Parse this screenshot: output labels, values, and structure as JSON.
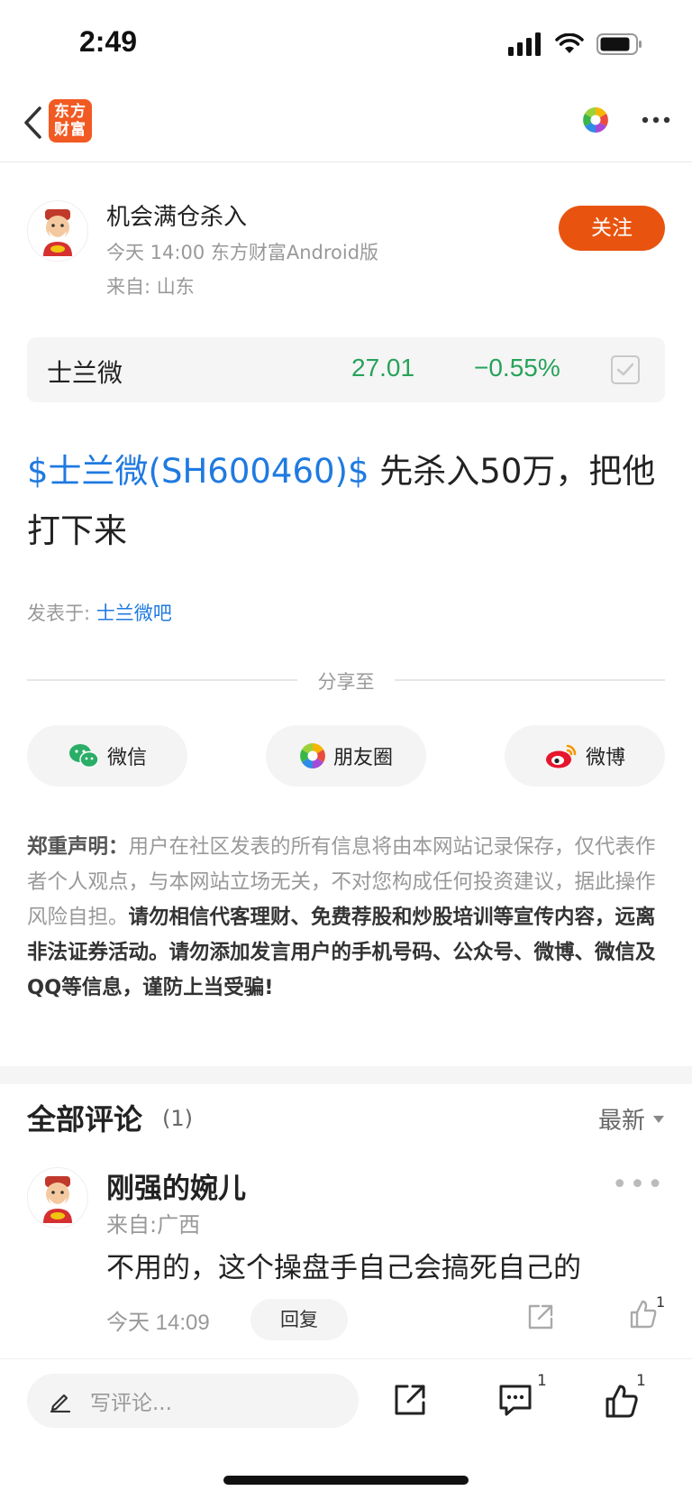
{
  "status_bar": {
    "time": "2:49"
  },
  "nav": {
    "logo_text_line1": "东方",
    "logo_text_line2": "财富"
  },
  "author": {
    "name": "机会满仓杀入",
    "meta": "今天 14:00 东方财富Android版",
    "location": "来自: 山东",
    "follow_label": "关注"
  },
  "stock": {
    "name": "士兰微",
    "price": "27.01",
    "change": "−0.55%"
  },
  "post": {
    "stock_link": "$士兰微(SH600460)$",
    "text": "先杀入50万，把他打下来",
    "posted_in_label": "发表于:",
    "posted_in_link": "士兰微吧"
  },
  "share": {
    "label": "分享至",
    "buttons": [
      {
        "label": "微信",
        "icon": "wechat-icon"
      },
      {
        "label": "朋友圈",
        "icon": "moments-icon"
      },
      {
        "label": "微博",
        "icon": "weibo-icon"
      }
    ]
  },
  "disclaimer": {
    "title": "郑重声明：",
    "normal": "用户在社区发表的所有信息将由本网站记录保存，仅代表作者个人观点，与本网站立场无关，不对您构成任何投资建议，据此操作风险自担。",
    "bold": "请勿相信代客理财、免费荐股和炒股培训等宣传内容，远离非法证券活动。请勿添加发言用户的手机号码、公众号、微博、微信及QQ等信息，谨防上当受骗!"
  },
  "comments": {
    "title": "全部评论",
    "count": "(1)",
    "sort_label": "最新",
    "items": [
      {
        "user": "刚强的婉儿",
        "location": "来自:广西",
        "text": "不用的，这个操盘手自己会搞死自己的",
        "time": "今天 14:09",
        "reply_label": "回复",
        "like_count": "1"
      }
    ]
  },
  "bottom_bar": {
    "input_placeholder": "写评论...",
    "comment_count": "1",
    "like_count": "1"
  },
  "colors": {
    "accent_orange": "#e8540f",
    "link_blue": "#1f7ae0",
    "stock_green": "#27a35a"
  }
}
